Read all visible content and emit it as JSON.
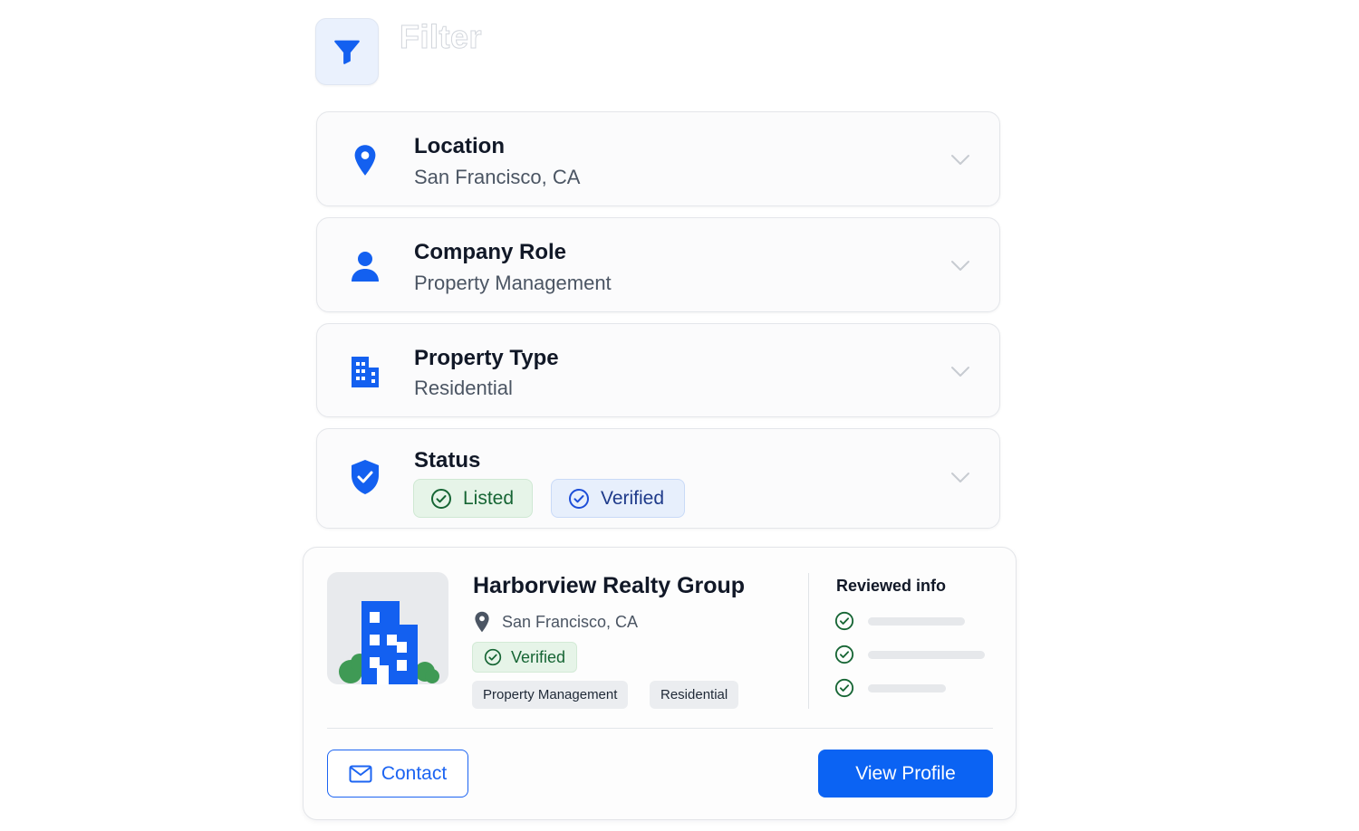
{
  "header": {
    "title": "Filter",
    "icon": "funnel-icon"
  },
  "filters": [
    {
      "title": "Location",
      "value": "San Francisco, CA",
      "icon": "map-pin-icon"
    },
    {
      "title": "Company Role",
      "value": "Property Management",
      "icon": "person-icon"
    },
    {
      "title": "Property Type",
      "value": "Residential",
      "icon": "building-icon"
    },
    {
      "title": "Status",
      "icon": "shield-check-icon",
      "chips": [
        {
          "label": "Listed",
          "icon": "check-circle-icon"
        },
        {
          "label": "Verified",
          "icon": "check-circle-icon"
        }
      ]
    }
  ],
  "card": {
    "name": "Harborview Realty Group",
    "location": "San Francisco, CA",
    "badge": "Verified",
    "tags": [
      "Property Management",
      "Residential"
    ],
    "reviewed_title": "Reviewed info",
    "reviewed_count": 3,
    "contact_label": "Contact",
    "view_label": "View Profile"
  },
  "colors": {
    "accent": "#0b63f3",
    "success": "#166534",
    "success_bg": "#e6f4e8",
    "info_bg": "#e7effc",
    "tree": "#3f9a55"
  }
}
